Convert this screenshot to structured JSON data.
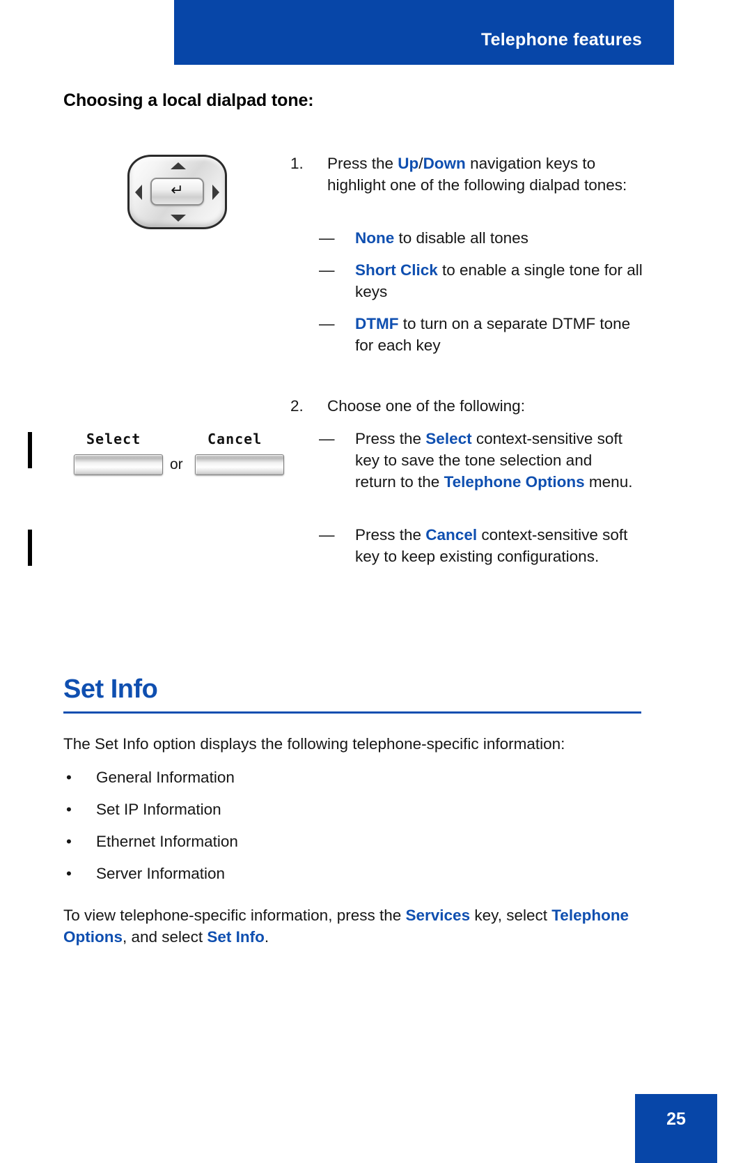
{
  "header": {
    "title": "Telephone features"
  },
  "page_title": "Choosing a local dialpad tone:",
  "icons": {
    "enter_glyph": "↵",
    "dash": "—",
    "bullet": "•"
  },
  "steps": [
    {
      "number": "1.",
      "text_before": "Press the ",
      "term_a": "Up",
      "separator": "/",
      "term_b": "Down",
      "text_after": " navigation keys to highlight one of the following dialpad tones:"
    },
    {
      "number": "2.",
      "text": "Choose one of the following:"
    }
  ],
  "tone_options": [
    {
      "term": "None",
      "text": " to disable all tones"
    },
    {
      "term": "Short Click",
      "text": " to enable a single tone for all keys"
    },
    {
      "term": "DTMF",
      "text": " to turn on a separate DTMF tone for each key"
    }
  ],
  "softkey_actions": [
    {
      "lead": "Press the ",
      "term": "Select",
      "mid": " context-sensitive soft key to save the tone selection and return to the ",
      "term2": "Telephone Options",
      "tail": " menu."
    },
    {
      "lead": "Press the ",
      "term": "Cancel",
      "mid": " context-sensitive soft key to keep existing configurations.",
      "term2": "",
      "tail": ""
    }
  ],
  "softkeys": {
    "select_label": "Select",
    "cancel_label": "Cancel",
    "or_label": "or"
  },
  "section": {
    "heading": "Set Info",
    "intro": "The Set Info option displays the following telephone-specific information:",
    "bullets": [
      "General Information",
      "Set IP Information",
      "Ethernet Information",
      "Server Information"
    ],
    "closing": {
      "part1": "To view telephone-specific information, press the ",
      "term1": "Services",
      "part2": " key, select ",
      "term2": "Telephone Options",
      "part3": ", and select ",
      "term3": "Set Info",
      "part4": "."
    }
  },
  "footer": {
    "page_number": "25"
  },
  "colors": {
    "brand_blue": "#0746a8",
    "link_blue": "#0f4fb0",
    "body_text": "#161616"
  }
}
